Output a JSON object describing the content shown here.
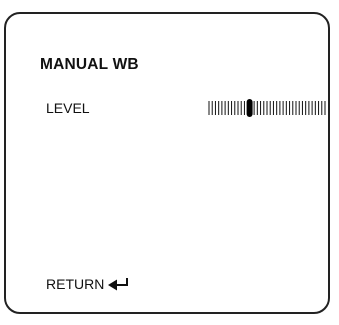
{
  "menu": {
    "title": "MANUAL WB",
    "items": [
      {
        "label": "LEVEL",
        "level_fraction": 0.35,
        "tick_count": 37
      }
    ],
    "return_label": "RETURN",
    "return_icon": "enter-arrow-icon"
  }
}
